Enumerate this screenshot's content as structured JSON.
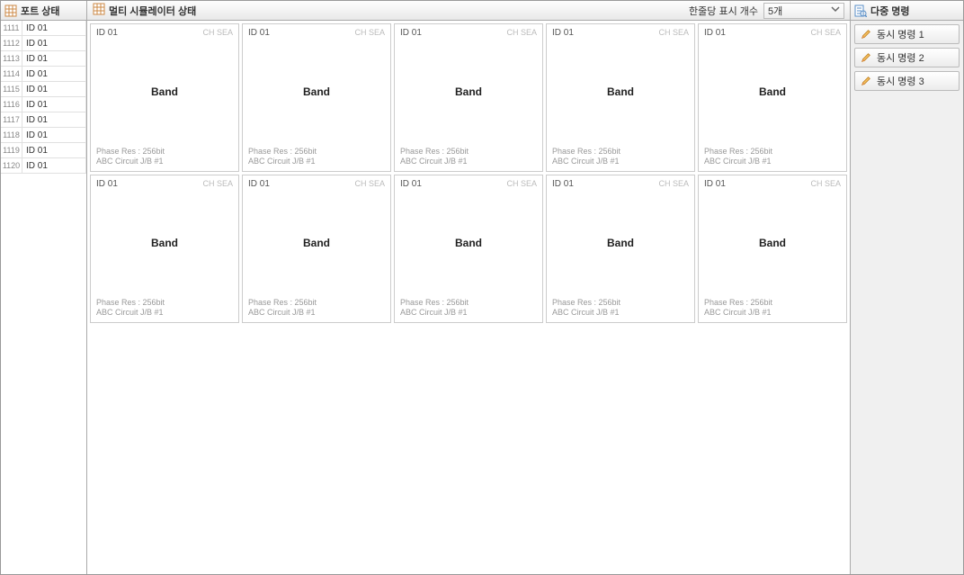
{
  "left": {
    "title": "포트 상태",
    "ports": [
      {
        "num": "1111",
        "id": "ID 01"
      },
      {
        "num": "1112",
        "id": "ID 01"
      },
      {
        "num": "1113",
        "id": "ID 01"
      },
      {
        "num": "1114",
        "id": "ID 01"
      },
      {
        "num": "1115",
        "id": "ID 01"
      },
      {
        "num": "1116",
        "id": "ID 01"
      },
      {
        "num": "1117",
        "id": "ID 01"
      },
      {
        "num": "1118",
        "id": "ID 01"
      },
      {
        "num": "1119",
        "id": "ID 01"
      },
      {
        "num": "1120",
        "id": "ID 01"
      }
    ]
  },
  "center": {
    "title": "멀티 시뮬레이터 상태",
    "count_label": "한줄당 표시 개수",
    "count_value": "5개",
    "cards": [
      {
        "id": "ID 01",
        "ch": "CH SEA",
        "band": "Band",
        "phase": "Phase Res : 256bit",
        "circuit": "ABC Circuit J/B #1"
      },
      {
        "id": "ID 01",
        "ch": "CH SEA",
        "band": "Band",
        "phase": "Phase Res : 256bit",
        "circuit": "ABC Circuit J/B #1"
      },
      {
        "id": "ID 01",
        "ch": "CH SEA",
        "band": "Band",
        "phase": "Phase Res : 256bit",
        "circuit": "ABC Circuit J/B #1"
      },
      {
        "id": "ID 01",
        "ch": "CH SEA",
        "band": "Band",
        "phase": "Phase Res : 256bit",
        "circuit": "ABC Circuit J/B #1"
      },
      {
        "id": "ID 01",
        "ch": "CH SEA",
        "band": "Band",
        "phase": "Phase Res : 256bit",
        "circuit": "ABC Circuit J/B #1"
      },
      {
        "id": "ID 01",
        "ch": "CH SEA",
        "band": "Band",
        "phase": "Phase Res : 256bit",
        "circuit": "ABC Circuit J/B #1"
      },
      {
        "id": "ID 01",
        "ch": "CH SEA",
        "band": "Band",
        "phase": "Phase Res : 256bit",
        "circuit": "ABC Circuit J/B #1"
      },
      {
        "id": "ID 01",
        "ch": "CH SEA",
        "band": "Band",
        "phase": "Phase Res : 256bit",
        "circuit": "ABC Circuit J/B #1"
      },
      {
        "id": "ID 01",
        "ch": "CH SEA",
        "band": "Band",
        "phase": "Phase Res : 256bit",
        "circuit": "ABC Circuit J/B #1"
      },
      {
        "id": "ID 01",
        "ch": "CH SEA",
        "band": "Band",
        "phase": "Phase Res : 256bit",
        "circuit": "ABC Circuit J/B #1"
      }
    ]
  },
  "right": {
    "title": "다중 명령",
    "commands": [
      {
        "label": "동시 명령 1"
      },
      {
        "label": "동시 명령 2"
      },
      {
        "label": "동시 명령 3"
      }
    ]
  }
}
